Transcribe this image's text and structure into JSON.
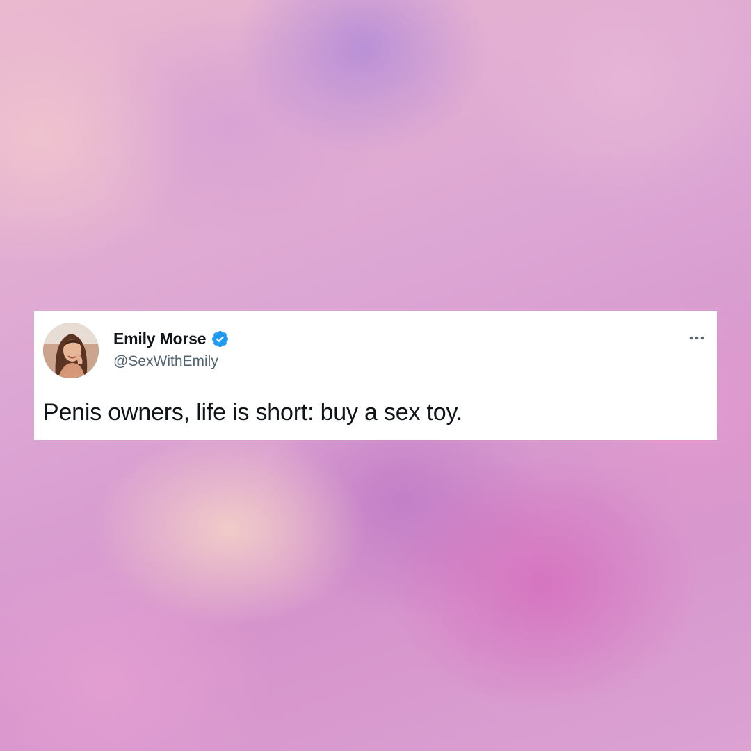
{
  "tweet": {
    "display_name": "Emily Morse",
    "handle": "@SexWithEmily",
    "text": "Penis owners, life is short: buy a sex toy.",
    "verified": true,
    "verified_badge_color": "#1d9bf0",
    "more_icon": "more-horizontal-icon",
    "avatar_icon": "profile-photo"
  },
  "colors": {
    "card_background": "#ffffff",
    "name_color": "#0f1419",
    "handle_color": "#536471",
    "text_color": "#0f1419"
  }
}
